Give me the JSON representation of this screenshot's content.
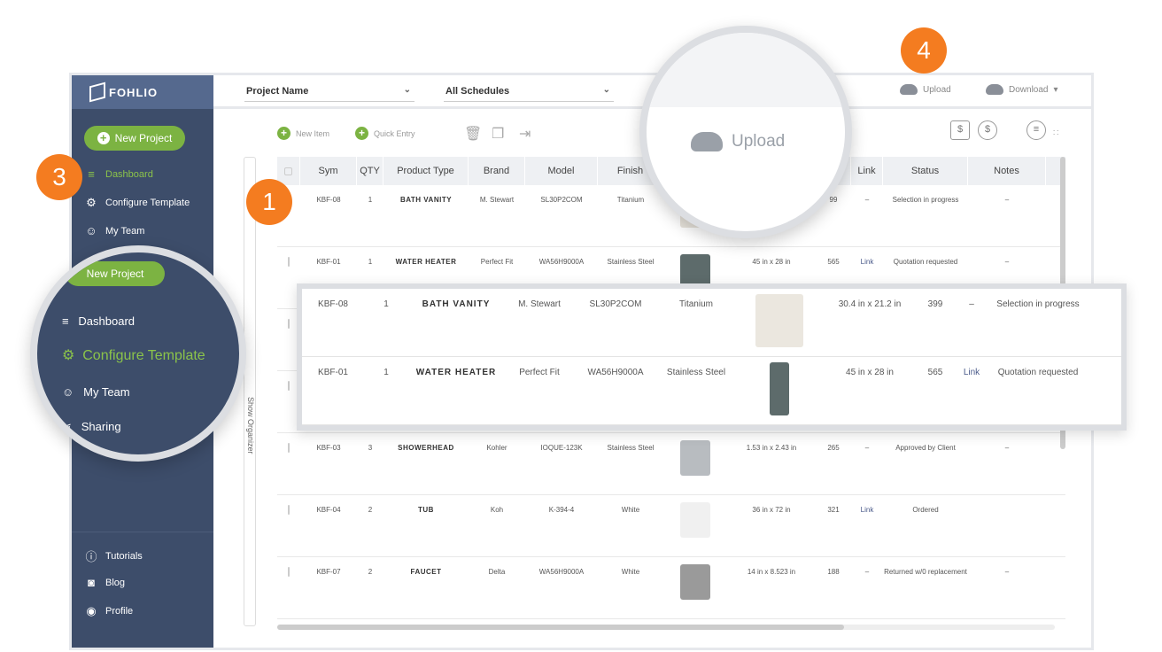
{
  "brand": "FOHLIO",
  "colors": {
    "accent": "#7cb342",
    "sidebar": "#3d4d6a",
    "badge": "#f47c20"
  },
  "sidebar": {
    "new_project": "New Project",
    "items": [
      {
        "label": "Dashboard",
        "icon": "list-icon"
      },
      {
        "label": "Configure Template",
        "icon": "gear-icon"
      },
      {
        "label": "My Team",
        "icon": "team-icon"
      },
      {
        "label": "Sharing",
        "icon": "share-icon"
      }
    ],
    "bottom": [
      {
        "label": "Tutorials",
        "icon": "info-icon"
      },
      {
        "label": "Blog",
        "icon": "rss-icon"
      },
      {
        "label": "Profile",
        "icon": "user-icon"
      }
    ]
  },
  "topbar": {
    "project": "Project Name",
    "schedule": "All Schedules",
    "upload": "Upload",
    "download": "Download"
  },
  "toolbar": {
    "new_item": "New Item",
    "quick_entry": "Quick Entry"
  },
  "organizer": "Show Organizer",
  "table": {
    "headers": [
      "Sym",
      "QTY",
      "Product Type",
      "Brand",
      "Model",
      "Finish",
      "",
      "",
      "",
      "Link",
      "Status",
      "Notes"
    ],
    "rows": [
      [
        "KBF-08",
        "1",
        "BATH VANITY",
        "M. Stewart",
        "SL30P2COM",
        "Titanium",
        "",
        "",
        "99",
        "–",
        "Selection in progress",
        "–"
      ],
      [
        "KBF-01",
        "1",
        "WATER HEATER",
        "Perfect Fit",
        "WA56H9000A",
        "Stainless Steel",
        "",
        "45 in x 28 in",
        "565",
        "Link",
        "Quotation requested",
        "–"
      ],
      [
        "",
        "",
        "",
        "",
        "",
        "",
        "",
        "",
        "",
        "",
        "",
        ""
      ],
      [
        "",
        "",
        "",
        "",
        "",
        "",
        "",
        "",
        "",
        "",
        "",
        ""
      ],
      [
        "KBF-03",
        "3",
        "SHOWERHEAD",
        "Kohler",
        "IOQUE-123K",
        "Stainless Steel",
        "",
        "1.53 in x 2.43 in",
        "265",
        "–",
        "Approved by Client",
        "–"
      ],
      [
        "KBF-04",
        "2",
        "TUB",
        "Koh",
        "K-394-4",
        "White",
        "",
        "36 in x 72 in",
        "321",
        "Link",
        "Ordered",
        ""
      ],
      [
        "KBF-07",
        "2",
        "FAUCET",
        "Delta",
        "WA56H9000A",
        "White",
        "",
        "14 in x 8.523 in",
        "188",
        "–",
        "Returned w/0 replacement",
        "–"
      ]
    ]
  },
  "zoom_rows": [
    [
      "KBF-08",
      "1",
      "BATH VANITY",
      "M. Stewart",
      "SL30P2COM",
      "Titanium",
      "30.4 in x 21.2 in",
      "399",
      "–",
      "Selection in progress"
    ],
    [
      "KBF-01",
      "1",
      "WATER HEATER",
      "Perfect Fit",
      "WA56H9000A",
      "Stainless Steel",
      "45 in x 28 in",
      "565",
      "Link",
      "Quotation requested"
    ]
  ],
  "magnifier_left": {
    "new_project": "New Project",
    "items": [
      "Dashboard",
      "Configure Template",
      "My Team",
      "Sharing"
    ]
  },
  "magnifier_upload": "Upload",
  "badges": [
    "1",
    "3",
    "4"
  ]
}
